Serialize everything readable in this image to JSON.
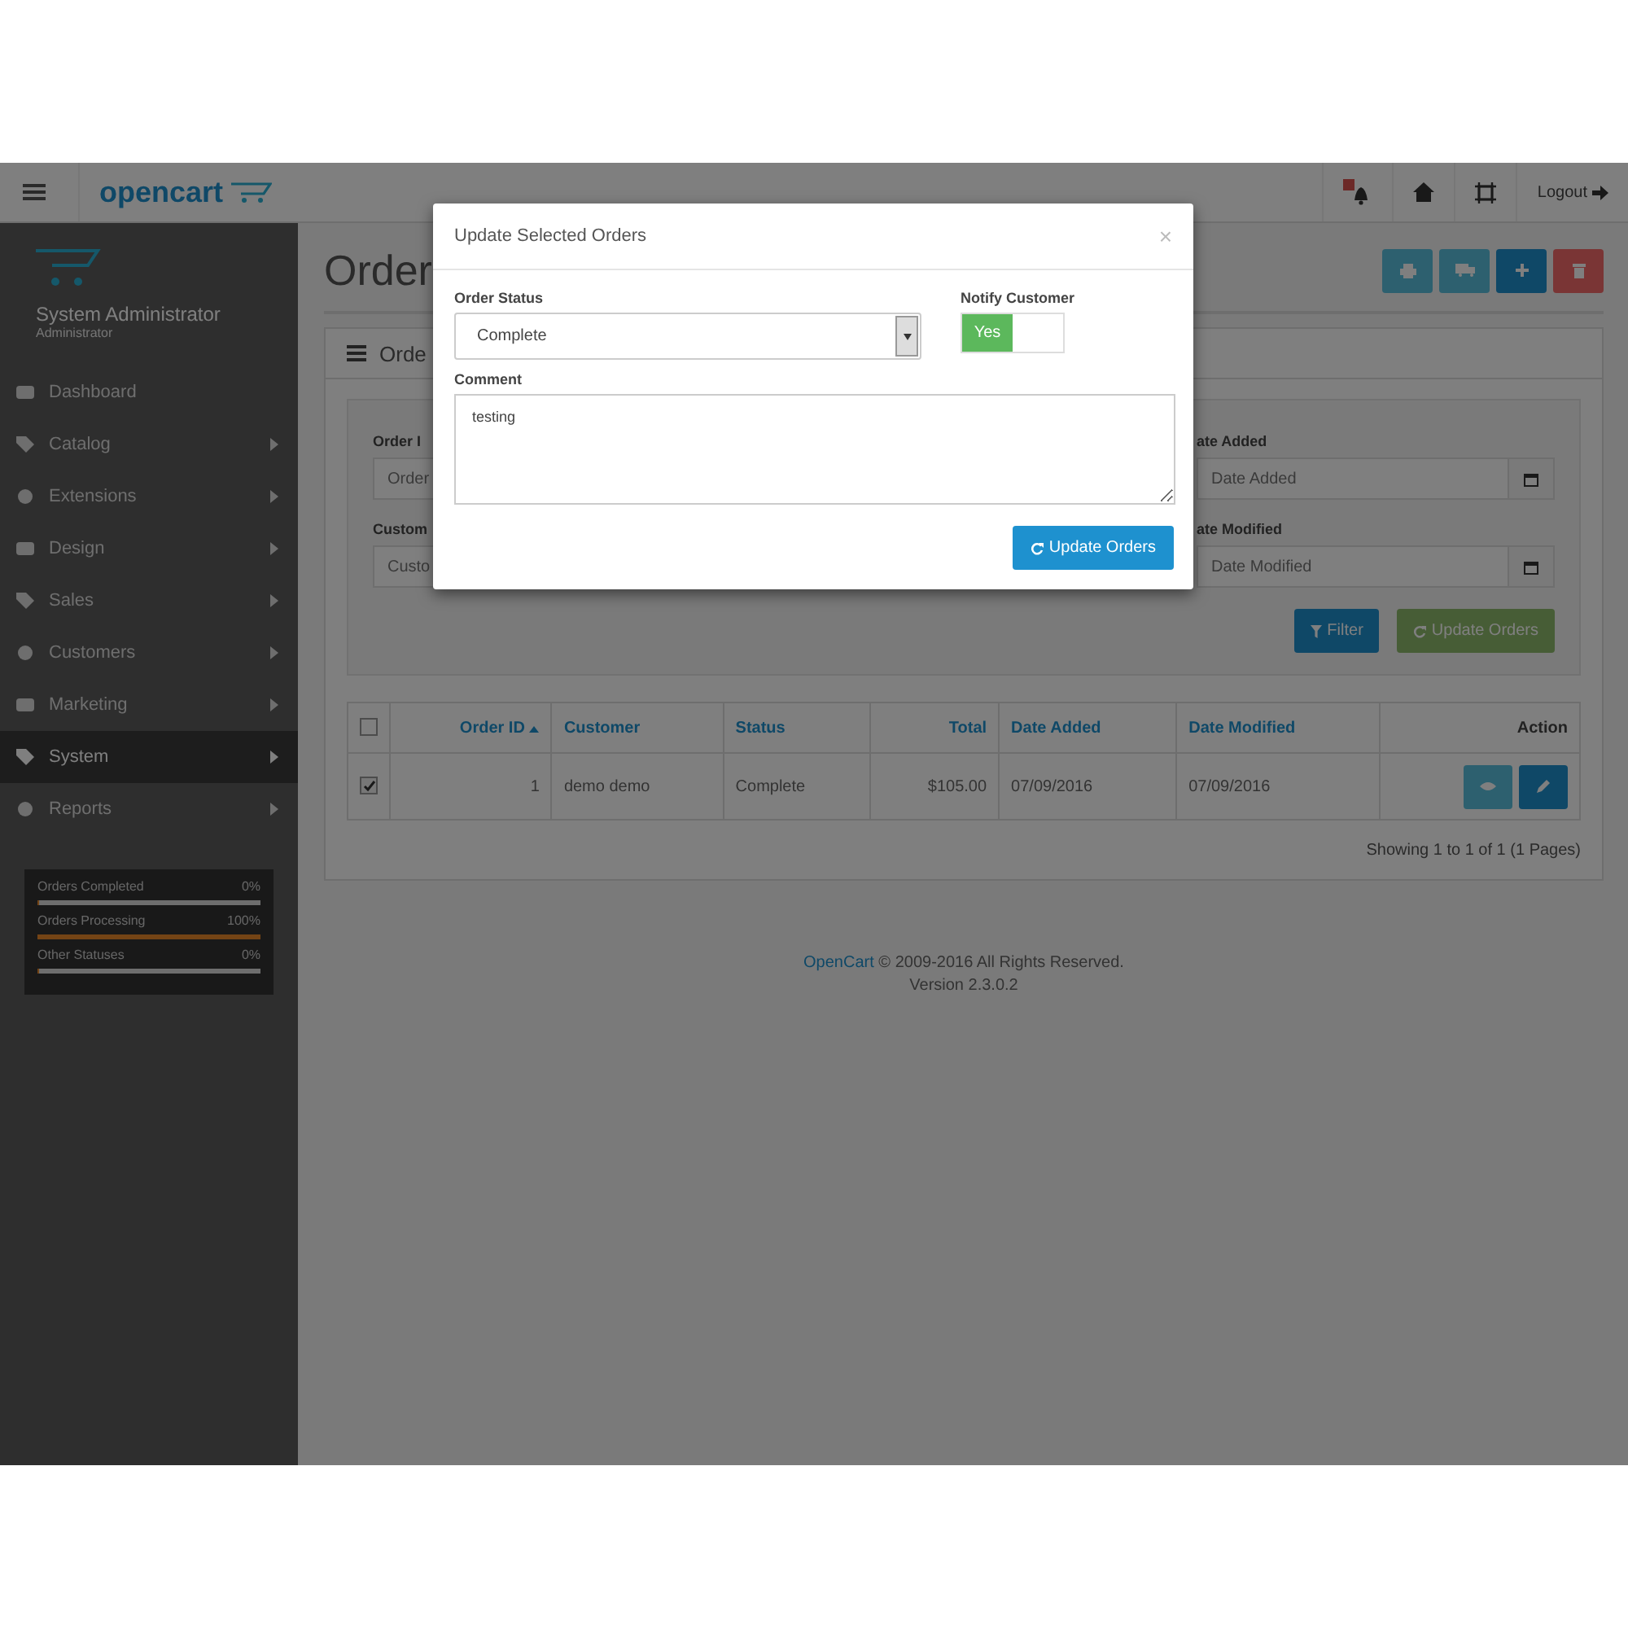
{
  "header": {
    "logo": "opencart",
    "logout": "Logout"
  },
  "sidebar": {
    "user_name": "System Administrator",
    "user_role": "Administrator",
    "items": [
      {
        "label": "Dashboard",
        "selected": false,
        "has_children": false
      },
      {
        "label": "Catalog",
        "selected": false,
        "has_children": true
      },
      {
        "label": "Extensions",
        "selected": false,
        "has_children": true
      },
      {
        "label": "Design",
        "selected": false,
        "has_children": true
      },
      {
        "label": "Sales",
        "selected": false,
        "has_children": true
      },
      {
        "label": "Customers",
        "selected": false,
        "has_children": true
      },
      {
        "label": "Marketing",
        "selected": false,
        "has_children": true
      },
      {
        "label": "System",
        "selected": true,
        "has_children": true
      },
      {
        "label": "Reports",
        "selected": false,
        "has_children": true
      }
    ],
    "stats": [
      {
        "label": "Orders Completed",
        "reading": "0%",
        "level": 0
      },
      {
        "label": "Orders Processing",
        "reading": "100%",
        "level": 1
      },
      {
        "label": "Other Statuses",
        "reading": "0%",
        "level": 0
      }
    ]
  },
  "page": {
    "title": "Order",
    "panel_heading": "Orde",
    "filters_left": [
      {
        "label": "Order I",
        "placeholder": "Order"
      },
      {
        "label": "Custom",
        "placeholder": "Custo"
      }
    ],
    "filters_right": [
      {
        "label": "ate Added",
        "placeholder": "Date Added"
      },
      {
        "label": "ate Modified",
        "placeholder": "Date Modified"
      }
    ],
    "filter_button": "Filter",
    "update_button": "Update Orders",
    "table": {
      "header_checked": false,
      "columns": [
        {
          "label": "Order ID"
        },
        {
          "label": "Customer"
        },
        {
          "label": "Status"
        },
        {
          "label": "Total"
        },
        {
          "label": "Date Added"
        },
        {
          "label": "Date Modified"
        },
        {
          "label": "Action"
        }
      ],
      "rows": [
        {
          "checked": true,
          "cells": [
            "1",
            "demo demo",
            "Complete",
            "$105.00",
            "07/09/2016",
            "07/09/2016"
          ]
        }
      ]
    },
    "pagination": "Showing 1 to 1 of 1 (1 Pages)"
  },
  "footer": {
    "link": "OpenCart",
    "copyright": "© 2009-2016 All Rights Reserved.",
    "version": "Version 2.3.0.2"
  },
  "modal": {
    "title": "Update Selected Orders",
    "close": "×",
    "status_label": "Order Status",
    "status_value": "Complete",
    "notify_label": "Notify Customer",
    "notify_on": true,
    "notify_text": "Yes",
    "comment_label": "Comment",
    "comment_value": "testing",
    "button": "Update Orders"
  }
}
